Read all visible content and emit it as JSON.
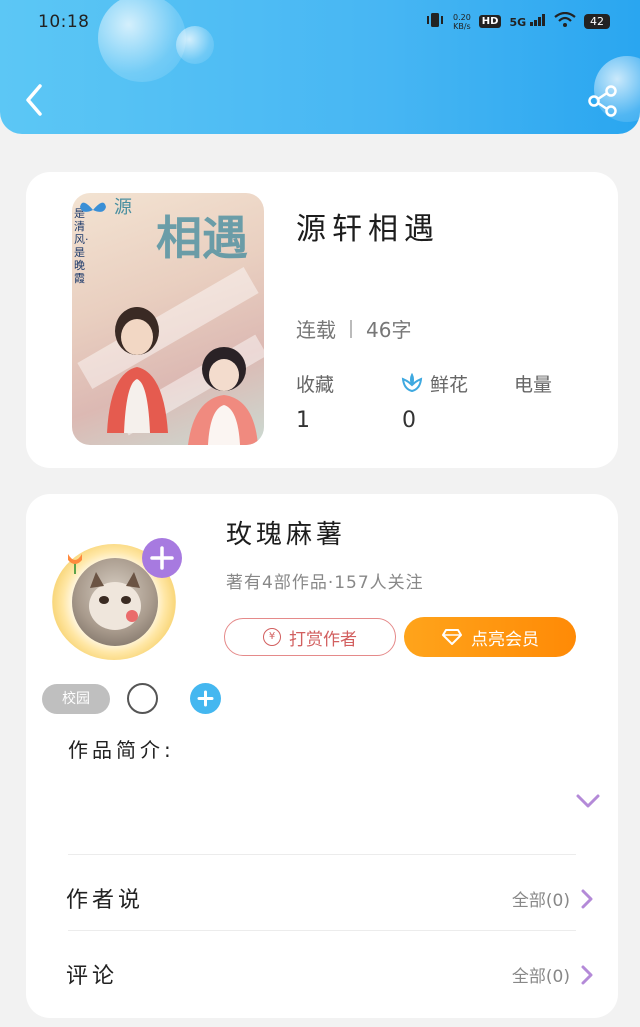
{
  "status_bar": {
    "time": "10:18",
    "net_speed": "0.20",
    "net_unit": "KB/s",
    "hd": "HD",
    "signal": "5G",
    "battery": "42"
  },
  "book": {
    "title": "源轩相遇",
    "status": "连载",
    "word_count": "46字",
    "collect_label": "收藏",
    "collect_count": "1",
    "flower_label": "鲜花",
    "flower_count": "0",
    "power_label": "电量",
    "cover": {
      "text_top": "源",
      "title": "相遇",
      "side_text": "是清风·是晚霞"
    }
  },
  "author": {
    "name": "玫瑰麻薯",
    "stats": "著有4部作品·157人关注",
    "tip_label": "打赏作者",
    "vip_label": "点亮会员",
    "tag": "校园"
  },
  "sections": {
    "intro_label": "作品简介:",
    "author_says_label": "作者说",
    "author_says_link": "全部(0)",
    "comments_label": "评论",
    "comments_link": "全部(0)"
  },
  "colors": {
    "header": "#47b6f3",
    "vip": "#ff9410",
    "tip": "#d25f5f",
    "accent_purple": "#a77ae0",
    "add_blue": "#44b7f0"
  }
}
